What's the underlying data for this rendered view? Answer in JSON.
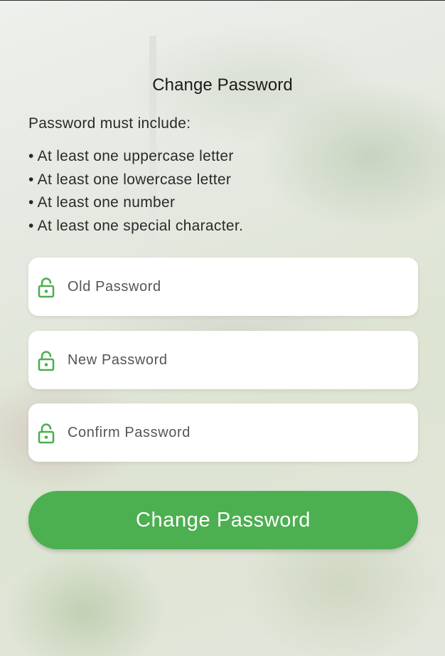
{
  "page": {
    "title": "Change Password"
  },
  "rules": {
    "intro": "Password must include:",
    "items": [
      "At least one uppercase letter",
      "At least one lowercase letter",
      "At least one number",
      "At least one special character."
    ]
  },
  "fields": {
    "old_password": {
      "label": "Old Password",
      "icon": "lock-open-icon"
    },
    "new_password": {
      "label": "New Password",
      "icon": "lock-open-icon"
    },
    "confirm_password": {
      "label": "Confirm Password",
      "icon": "lock-open-icon"
    }
  },
  "submit": {
    "label": "Change Password"
  },
  "colors": {
    "accent": "#4caf50",
    "field_bg": "#ffffff",
    "title_text": "#1b1b1b"
  }
}
